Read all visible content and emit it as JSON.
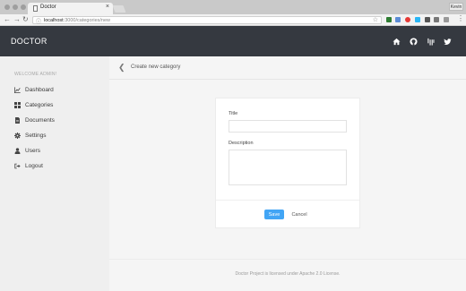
{
  "browser": {
    "tab_title": "Doctor",
    "tab_close": "×",
    "profile": "Kevin",
    "url_host": "localhost",
    "url_path": ":3000/categories/new"
  },
  "header": {
    "brand": "DOCTOR",
    "background": "#353940"
  },
  "sidebar": {
    "welcome": "WELCOME ADMIN!",
    "items": [
      {
        "label": "Dashboard",
        "icon": "chart-line-icon"
      },
      {
        "label": "Categories",
        "icon": "grid-icon"
      },
      {
        "label": "Documents",
        "icon": "file-icon"
      },
      {
        "label": "Settings",
        "icon": "gear-icon"
      },
      {
        "label": "Users",
        "icon": "user-icon"
      },
      {
        "label": "Logout",
        "icon": "logout-icon"
      }
    ]
  },
  "main": {
    "breadcrumb": "Create new category",
    "form": {
      "title_label": "Title",
      "title_value": "",
      "description_label": "Description",
      "description_value": "",
      "save_label": "Save",
      "cancel_label": "Cancel"
    },
    "footer": "Doctor Project is licensed under Apache 2.0 License."
  },
  "colors": {
    "accent": "#42a5f5"
  }
}
